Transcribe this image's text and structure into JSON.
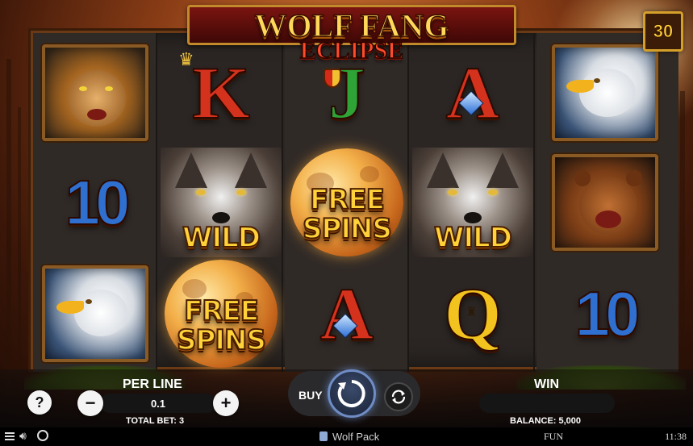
{
  "logo": {
    "title": "WOLF FANG",
    "subtitle": "ECLIPSE"
  },
  "ways_badge": "30",
  "reels": {
    "col1": [
      "leopard",
      "10",
      "eagle"
    ],
    "col2": [
      "K",
      "WILD",
      "FREE SPINS"
    ],
    "col3": [
      "J",
      "FREE SPINS",
      "A"
    ],
    "col4": [
      "A",
      "WILD",
      "Q"
    ],
    "col5": [
      "eagle",
      "bear",
      "10"
    ]
  },
  "symbols": {
    "wild": "WILD",
    "free1": "FREE",
    "free2": "SPINS",
    "ten": "10",
    "king": "K",
    "jack": "J",
    "ace": "A",
    "queen": "Q"
  },
  "controls": {
    "help": "?",
    "per_line_label": "PER LINE",
    "per_line_value": "0.1",
    "minus": "−",
    "plus": "+",
    "total_bet": "TOTAL BET: 3",
    "buy": "BUY",
    "win_label": "WIN",
    "balance": "BALANCE: 5,000"
  },
  "status": {
    "game_name": "Wolf Pack",
    "mode": "FUN",
    "time": "11:38"
  },
  "colors": {
    "accent_gold": "#ffd23a",
    "spin_ring": "#6f8cc4"
  }
}
